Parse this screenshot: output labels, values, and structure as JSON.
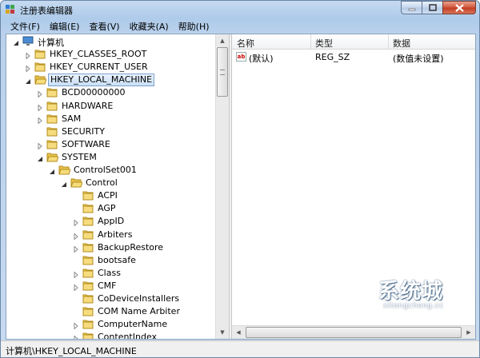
{
  "window": {
    "title": "注册表编辑器"
  },
  "menu": [
    "文件(F)",
    "编辑(E)",
    "查看(V)",
    "收藏夹(A)",
    "帮助(H)"
  ],
  "tree": [
    {
      "label": "计算机",
      "level": 0,
      "icon": "computer-icon",
      "expander": "expanded"
    },
    {
      "label": "HKEY_CLASSES_ROOT",
      "level": 1,
      "icon": "folder-icon",
      "expander": "collapsed"
    },
    {
      "label": "HKEY_CURRENT_USER",
      "level": 1,
      "icon": "folder-icon",
      "expander": "collapsed"
    },
    {
      "label": "HKEY_LOCAL_MACHINE",
      "level": 1,
      "icon": "folder-open-icon",
      "expander": "expanded",
      "selected": true
    },
    {
      "label": "BCD00000000",
      "level": 2,
      "icon": "folder-icon",
      "expander": "collapsed"
    },
    {
      "label": "HARDWARE",
      "level": 2,
      "icon": "folder-icon",
      "expander": "collapsed"
    },
    {
      "label": "SAM",
      "level": 2,
      "icon": "folder-icon",
      "expander": "collapsed"
    },
    {
      "label": "SECURITY",
      "level": 2,
      "icon": "folder-icon",
      "expander": "none"
    },
    {
      "label": "SOFTWARE",
      "level": 2,
      "icon": "folder-icon",
      "expander": "collapsed"
    },
    {
      "label": "SYSTEM",
      "level": 2,
      "icon": "folder-open-icon",
      "expander": "expanded"
    },
    {
      "label": "ControlSet001",
      "level": 3,
      "icon": "folder-open-icon",
      "expander": "expanded"
    },
    {
      "label": "Control",
      "level": 4,
      "icon": "folder-open-icon",
      "expander": "expanded"
    },
    {
      "label": "ACPI",
      "level": 5,
      "icon": "folder-icon",
      "expander": "none"
    },
    {
      "label": "AGP",
      "level": 5,
      "icon": "folder-icon",
      "expander": "none"
    },
    {
      "label": "AppID",
      "level": 5,
      "icon": "folder-icon",
      "expander": "collapsed"
    },
    {
      "label": "Arbiters",
      "level": 5,
      "icon": "folder-icon",
      "expander": "collapsed"
    },
    {
      "label": "BackupRestore",
      "level": 5,
      "icon": "folder-icon",
      "expander": "collapsed"
    },
    {
      "label": "bootsafe",
      "level": 5,
      "icon": "folder-icon",
      "expander": "none"
    },
    {
      "label": "Class",
      "level": 5,
      "icon": "folder-icon",
      "expander": "collapsed"
    },
    {
      "label": "CMF",
      "level": 5,
      "icon": "folder-icon",
      "expander": "collapsed"
    },
    {
      "label": "CoDeviceInstallers",
      "level": 5,
      "icon": "folder-icon",
      "expander": "none"
    },
    {
      "label": "COM Name Arbiter",
      "level": 5,
      "icon": "folder-icon",
      "expander": "none"
    },
    {
      "label": "ComputerName",
      "level": 5,
      "icon": "folder-icon",
      "expander": "collapsed"
    },
    {
      "label": "ContentIndex",
      "level": 5,
      "icon": "folder-icon",
      "expander": "collapsed"
    }
  ],
  "list": {
    "columns": [
      "名称",
      "类型",
      "数据"
    ],
    "rows": [
      {
        "name": "(默认)",
        "type": "REG_SZ",
        "data": "(数值未设置)",
        "icon": "string-value-icon"
      }
    ]
  },
  "status": {
    "path": "计算机\\HKEY_LOCAL_MACHINE"
  },
  "watermark": {
    "text": "系统城",
    "sub": "xitongcheng.cc"
  }
}
